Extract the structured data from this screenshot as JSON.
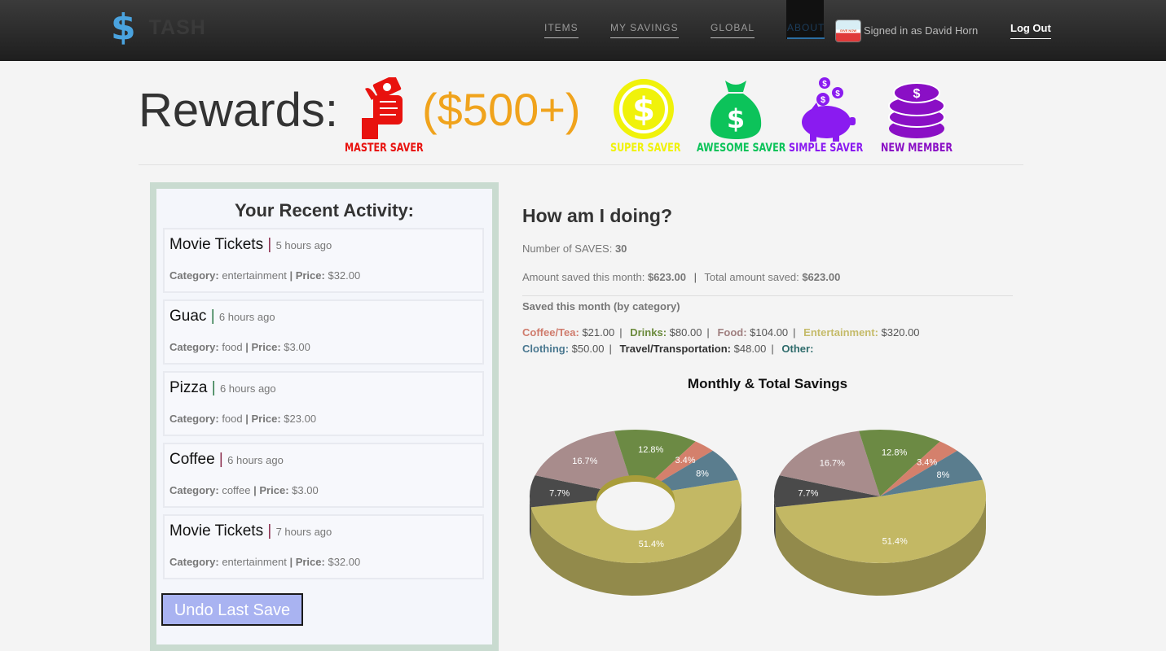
{
  "brand": {
    "symbol": "$",
    "name": "TASH"
  },
  "nav": {
    "items": "ITEMS",
    "my_savings": "MY SAVINGS",
    "global": "GLOBAL",
    "about": "ABOUT",
    "avatar_text": "GIVE NOW",
    "signed_in": "Signed in as David Horn",
    "logout": "Log Out"
  },
  "rewards": {
    "title": "Rewards:",
    "threshold": "($500+)",
    "badges": [
      {
        "label": "MASTER SAVER",
        "color": "#e8120e",
        "icon": "thumbs-up-money-icon"
      },
      {
        "label": "SUPER SAVER",
        "color": "#f0f20a",
        "icon": "dollar-coin-icon"
      },
      {
        "label": "AWESOME SAVER",
        "color": "#0cc35a",
        "icon": "money-bag-icon"
      },
      {
        "label": "SIMPLE SAVER",
        "color": "#8a1bf0",
        "icon": "piggy-bank-icon"
      },
      {
        "label": "NEW MEMBER",
        "color": "#8a0fc5",
        "icon": "coin-stack-icon"
      }
    ]
  },
  "activity": {
    "title": "Your Recent Activity:",
    "category_label": "Category:",
    "price_label": "Price:",
    "items": [
      {
        "name": "Movie Tickets",
        "time": "5 hours ago",
        "category": "entertainment",
        "price": "$32.00"
      },
      {
        "name": "Guac",
        "time": "6 hours ago",
        "category": "food",
        "price": "$3.00"
      },
      {
        "name": "Pizza",
        "time": "6 hours ago",
        "category": "food",
        "price": "$23.00"
      },
      {
        "name": "Coffee",
        "time": "6 hours ago",
        "category": "coffee",
        "price": "$3.00"
      },
      {
        "name": "Movie Tickets",
        "time": "7 hours ago",
        "category": "entertainment",
        "price": "$32.00"
      }
    ],
    "undo_label": "Undo Last Save"
  },
  "stats": {
    "title": "How am I doing?",
    "saves_label": "Number of SAVES:",
    "saves_value": "30",
    "month_label": "Amount saved this month:",
    "month_value": "$623.00",
    "total_label": "Total amount saved:",
    "total_value": "$623.00",
    "by_category_title": "Saved this month (by category)",
    "categories": [
      {
        "label": "Coffee/Tea:",
        "value": "$21.00",
        "color": "#cf7b6c"
      },
      {
        "label": "Drinks:",
        "value": "$80.00",
        "color": "#6b8a3c"
      },
      {
        "label": "Food:",
        "value": "$104.00",
        "color": "#a08080"
      },
      {
        "label": "Entertainment:",
        "value": "$320.00",
        "color": "#c5bb6a"
      },
      {
        "label": "Clothing:",
        "value": "$50.00",
        "color": "#4a7890"
      },
      {
        "label": "Travel/Transportation:",
        "value": "$48.00",
        "color": "#333333"
      },
      {
        "label": "Other:",
        "value": "",
        "color": "#2e6b6b"
      }
    ]
  },
  "chart_data": {
    "type": "pie",
    "title": "Monthly & Total Savings",
    "charts": [
      {
        "style": "donut-3d",
        "slices": [
          {
            "label": "51.4%",
            "value": 51.4,
            "color": "#c3b864"
          },
          {
            "label": "7.7%",
            "value": 7.7,
            "color": "#4a4a4a"
          },
          {
            "label": "16.7%",
            "value": 16.7,
            "color": "#a88c8c"
          },
          {
            "label": "12.8%",
            "value": 12.8,
            "color": "#6c8a44"
          },
          {
            "label": "3.4%",
            "value": 3.4,
            "color": "#d4806c"
          },
          {
            "label": "8%",
            "value": 8,
            "color": "#5a7d8e"
          }
        ]
      },
      {
        "style": "pie-3d",
        "slices": [
          {
            "label": "51.4%",
            "value": 51.4,
            "color": "#c3b864"
          },
          {
            "label": "7.7%",
            "value": 7.7,
            "color": "#4a4a4a"
          },
          {
            "label": "16.7%",
            "value": 16.7,
            "color": "#a88c8c"
          },
          {
            "label": "12.8%",
            "value": 12.8,
            "color": "#6c8a44"
          },
          {
            "label": "3.4%",
            "value": 3.4,
            "color": "#d4806c"
          },
          {
            "label": "8%",
            "value": 8,
            "color": "#5a7d8e"
          }
        ]
      }
    ]
  }
}
